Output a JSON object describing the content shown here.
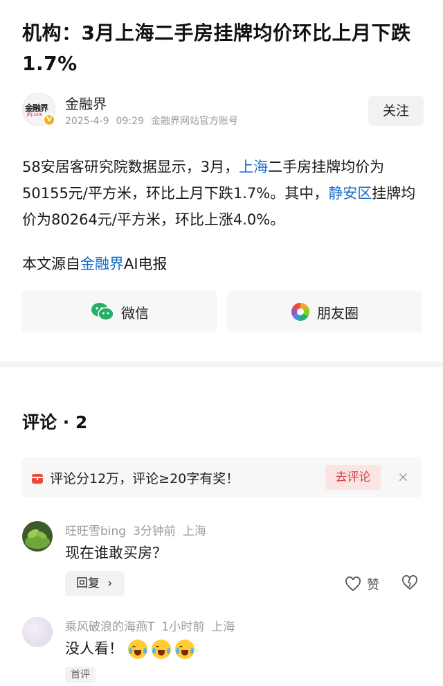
{
  "article": {
    "title": "机构：3月上海二手房挂牌均价环比上月下跌1.7%",
    "author": {
      "name": "金融界",
      "logo_text": "金融界",
      "logo_sub": "JRJ.com",
      "verified_mark": "V",
      "date": "2025-4-9",
      "time": "09:29",
      "account_desc": "金融界网站官方账号",
      "follow_label": "关注"
    },
    "body": {
      "p1_a": "58安居客研究院数据显示，3月，",
      "p1_link1": "上海",
      "p1_b": "二手房挂牌均价为50155元/平方米，环比上月下跌1.7%。其中，",
      "p1_link2": "静安区",
      "p1_c": "挂牌均价为80264元/平方米，环比上涨4.0%。"
    },
    "source": {
      "prefix": "本文源自",
      "link": "金融界",
      "suffix": "AI电报"
    }
  },
  "share": {
    "wechat_label": "微信",
    "moments_label": "朋友圈"
  },
  "comments": {
    "title": "评论 · 2",
    "promo": {
      "text": "评论分12万，评论≥20字有奖！",
      "button": "去评论",
      "close": "×"
    },
    "items": [
      {
        "user": "旺旺雪bing",
        "time": "3分钟前",
        "location": "上海",
        "text": "现在谁敢买房？",
        "reply_label": "回复",
        "like_label": "赞"
      },
      {
        "user": "乘风破浪的海燕T",
        "time": "1小时前",
        "location": "上海",
        "text": "没人看！",
        "badge": "首评"
      }
    ]
  },
  "colors": {
    "link": "#1a6ec7",
    "promo_button_bg": "#fbe4e4",
    "promo_button_text": "#d63a3a"
  }
}
